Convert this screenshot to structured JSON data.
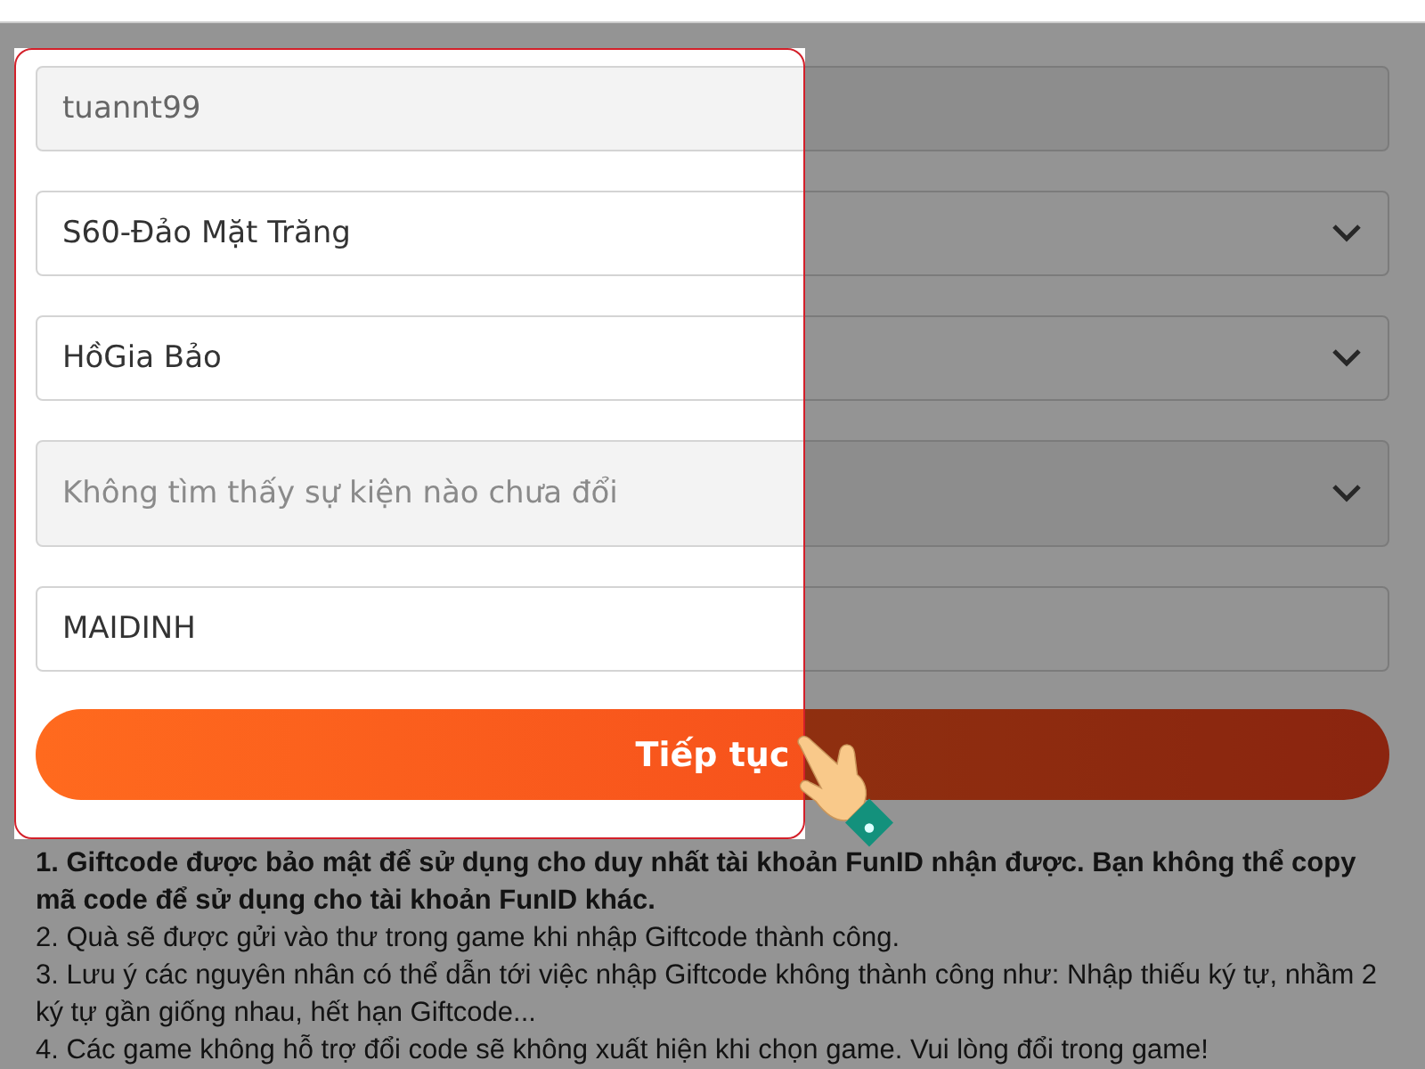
{
  "form": {
    "fields": [
      {
        "kind": "input",
        "value": "tuannt99",
        "disabled": true
      },
      {
        "kind": "select",
        "value": "S60-Đảo Mặt Trăng",
        "disabled": false
      },
      {
        "kind": "select",
        "value": "HồGia Bảo",
        "disabled": false
      },
      {
        "kind": "select",
        "placeholder": "Không tìm thấy sự kiện nào chưa đổi",
        "disabled": true
      },
      {
        "kind": "input",
        "value": "MAIDINH",
        "disabled": false
      }
    ],
    "submit": "Tiếp tục"
  },
  "notes": [
    {
      "text": "1. Giftcode được bảo mật để sử dụng cho duy nhất tài khoản FunID nhận được. Bạn không thể copy mã code để sử dụng cho tài khoản FunID khác.",
      "bold": true
    },
    {
      "text": "2. Quà sẽ được gửi vào thư trong game khi nhập Giftcode thành công.",
      "bold": false
    },
    {
      "text": "3. Lưu ý các nguyên nhân có thể dẫn tới việc nhập Giftcode không thành công như: Nhập thiếu ký tự, nhầm 2 ký tự gần giống nhau, hết hạn Giftcode...",
      "bold": false
    },
    {
      "text": "4. Các game không hỗ trợ đổi code sẽ không xuất hiện khi chọn game. Vui lòng đổi trong game!",
      "bold": false
    }
  ]
}
